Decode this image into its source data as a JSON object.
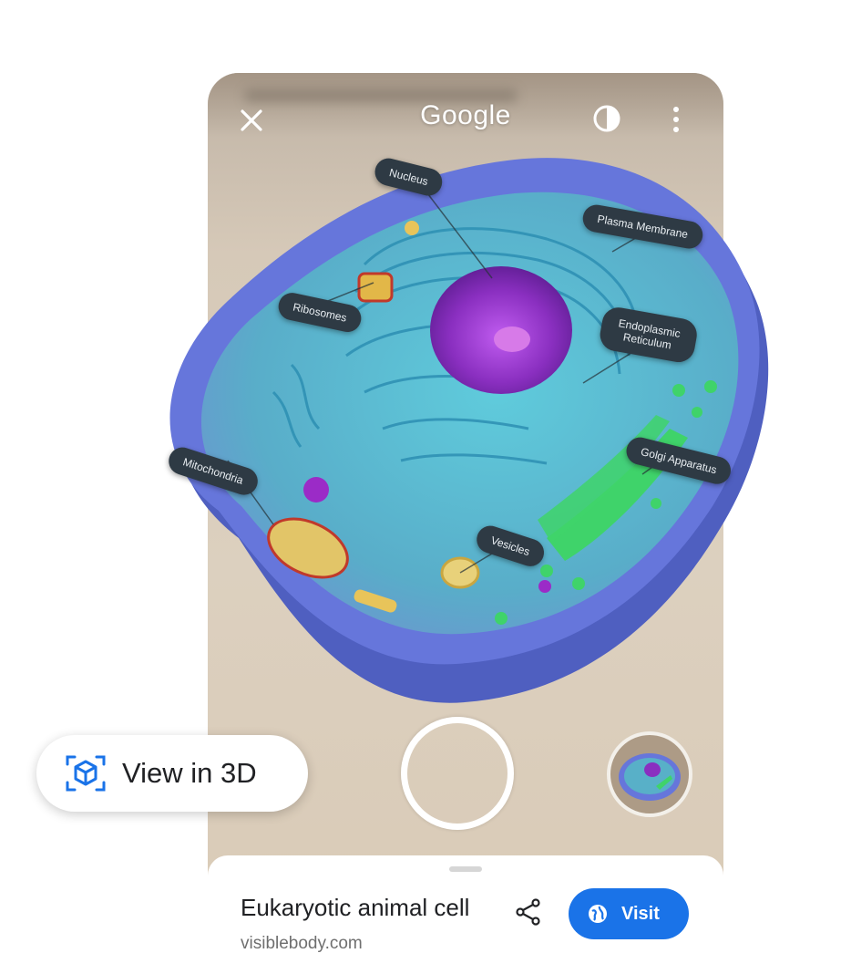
{
  "topbar": {
    "brand": "Google",
    "icons": [
      "close-icon",
      "contrast-icon",
      "more-vert-icon"
    ]
  },
  "annotations": {
    "nucleus": "Nucleus",
    "plasma_membrane": "Plasma Membrane",
    "ribosomes": "Ribosomes",
    "er_line1": "Endoplasmic",
    "er_line2": "Reticulum",
    "mitochondria": "Mitochondria",
    "golgi": "Golgi Apparatus",
    "vesicles": "Vesicles"
  },
  "controls": {
    "view_in_3d": "View in 3D",
    "view_icon": "3d-cube-icon",
    "shutter": "shutter-button",
    "thumbnail": "recent-capture-thumbnail"
  },
  "result": {
    "title": "Eukaryotic animal cell",
    "domain": "visiblebody.com",
    "visit_label": "Visit",
    "share_icon": "share-icon",
    "visit_icon": "globe-icon"
  },
  "colors": {
    "accent": "#1a73e8",
    "label_bg": "#2e3a44",
    "membrane": "#5a6fd4",
    "cytoplasm": "#4fb7c9",
    "nucleus": "#8a2fc0",
    "golgi": "#3fd36a"
  }
}
